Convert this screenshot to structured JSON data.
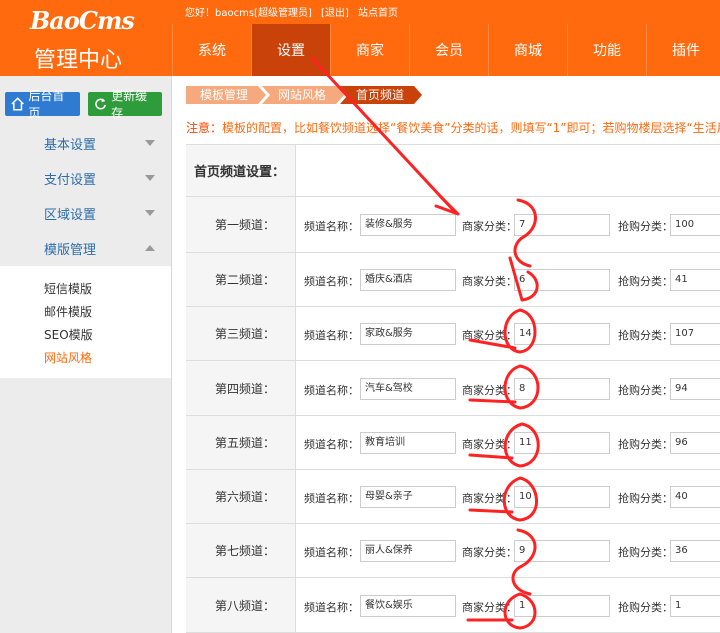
{
  "header": {
    "brand": "BaoCms",
    "subtitle": "管理中心",
    "top_links": [
      "您好！baocms[超级管理员]",
      "[退出]",
      "站点首页"
    ],
    "nav": [
      {
        "label": "系统",
        "active": false
      },
      {
        "label": "设置",
        "active": true
      },
      {
        "label": "商家",
        "active": false
      },
      {
        "label": "会员",
        "active": false
      },
      {
        "label": "商城",
        "active": false
      },
      {
        "label": "功能",
        "active": false
      },
      {
        "label": "插件",
        "active": false
      }
    ]
  },
  "sidebar": {
    "btn_home": "后台首页",
    "btn_cache": "更新缓存",
    "sections": [
      "基本设置",
      "支付设置",
      "区域设置",
      "模版管理"
    ],
    "sub_items": [
      "短信模版",
      "邮件模版",
      "SEO模版",
      "网站风格"
    ]
  },
  "breadcrumb": [
    "模板管理",
    "网站风格",
    "首页频道"
  ],
  "notice": {
    "prefix": "注意：",
    "text": "模板的配置，比如餐饮频道选择“餐饮美食”分类的话，则填写“1”即可；若购物楼层选择“生活用品"
  },
  "table": {
    "title": "首页频道设置：",
    "name_label": "频道名称：",
    "shop_label": "商家分类：",
    "tuan_label": "抢购分类：",
    "rows": [
      {
        "label": "第一频道：",
        "name": "装修&服务",
        "shop": "7",
        "tuan": "100"
      },
      {
        "label": "第二频道：",
        "name": "婚庆&酒店",
        "shop": "6",
        "tuan": "41"
      },
      {
        "label": "第三频道：",
        "name": "家政&服务",
        "shop": "14",
        "tuan": "107"
      },
      {
        "label": "第四频道：",
        "name": "汽车&驾校",
        "shop": "8",
        "tuan": "94"
      },
      {
        "label": "第五频道：",
        "name": "教育培训",
        "shop": "11",
        "tuan": "96"
      },
      {
        "label": "第六频道：",
        "name": "母婴&亲子",
        "shop": "10",
        "tuan": "40"
      },
      {
        "label": "第七频道：",
        "name": "丽人&保养",
        "shop": "9",
        "tuan": "36"
      },
      {
        "label": "第八频道：",
        "name": "餐饮&娱乐",
        "shop": "1",
        "tuan": "1"
      }
    ]
  },
  "colors": {
    "brand": "#ff6a0f",
    "nav_active": "#c9420a",
    "annotation": "#ff2222"
  }
}
